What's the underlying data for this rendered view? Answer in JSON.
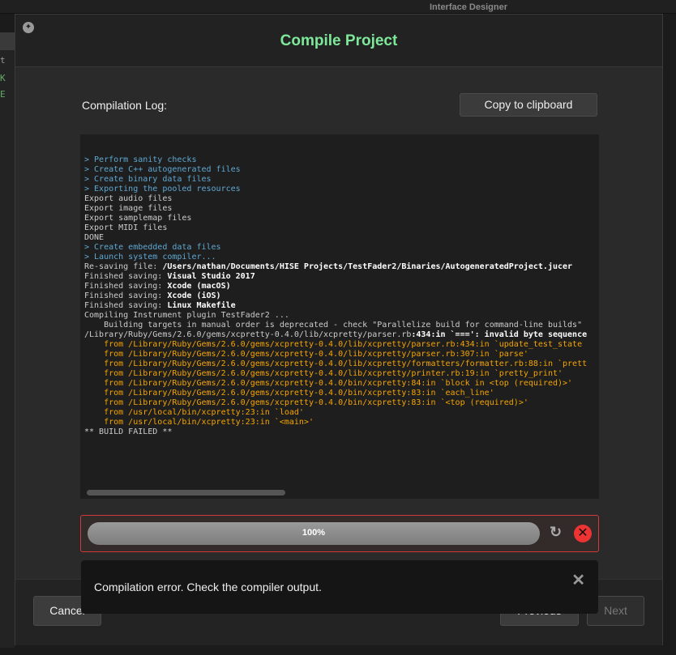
{
  "background": {
    "window_title": "Interface Designer",
    "left_items": [
      "t",
      "K",
      "E"
    ]
  },
  "dialog": {
    "title": "Compile Project",
    "log_label": "Compilation Log:",
    "copy_button": "Copy to clipboard",
    "log": [
      {
        "t": "> Perform sanity checks",
        "c": "blue"
      },
      {
        "t": "> Create C++ autogenerated files",
        "c": "blue"
      },
      {
        "t": "> Create binary data files",
        "c": "blue"
      },
      {
        "t": "> Exporting the pooled resources",
        "c": "blue"
      },
      {
        "t": "Export audio files",
        "c": ""
      },
      {
        "t": "Export image files",
        "c": ""
      },
      {
        "t": "Export samplemap files",
        "c": ""
      },
      {
        "t": "Export MIDI files",
        "c": ""
      },
      {
        "t": "DONE",
        "c": ""
      },
      {
        "t": "> Create embedded data files",
        "c": "blue"
      },
      {
        "t": "> Launch system compiler...",
        "c": "blue"
      },
      {
        "t": "Re-saving file:",
        "b": " /Users/nathan/Documents/HISE Projects/TestFader2/Binaries/AutogeneratedProject.jucer",
        "c": ""
      },
      {
        "t": "Finished saving:",
        "b": " Visual Studio 2017",
        "c": ""
      },
      {
        "t": "Finished saving:",
        "b": " Xcode (macOS)",
        "c": ""
      },
      {
        "t": "Finished saving:",
        "b": " Xcode (iOS)",
        "c": ""
      },
      {
        "t": "Finished saving:",
        "b": " Linux Makefile",
        "c": ""
      },
      {
        "t": "Compiling Instrument plugin TestFader2 ...",
        "c": ""
      },
      {
        "t": "    Building targets in manual order is deprecated - check \"Parallelize build for command-line builds\"",
        "c": ""
      },
      {
        "t": "/Library/Ruby/Gems/2.6.0/gems/xcpretty-0.4.0/lib/xcpretty/parser.rb",
        "b": ":434:in `===': invalid byte sequence",
        "c": ""
      },
      {
        "t": "    from /Library/Ruby/Gems/2.6.0/gems/xcpretty-0.4.0/lib/xcpretty/parser.rb:434:in `update_test_state",
        "c": "orange"
      },
      {
        "t": "    from /Library/Ruby/Gems/2.6.0/gems/xcpretty-0.4.0/lib/xcpretty/parser.rb:307:in `parse'",
        "c": "orange"
      },
      {
        "t": "    from /Library/Ruby/Gems/2.6.0/gems/xcpretty-0.4.0/lib/xcpretty/formatters/formatter.rb:88:in `prett",
        "c": "orange"
      },
      {
        "t": "    from /Library/Ruby/Gems/2.6.0/gems/xcpretty-0.4.0/lib/xcpretty/printer.rb:19:in `pretty_print'",
        "c": "orange"
      },
      {
        "t": "    from /Library/Ruby/Gems/2.6.0/gems/xcpretty-0.4.0/bin/xcpretty:84:in `block in <top (required)>'",
        "c": "orange"
      },
      {
        "t": "    from /Library/Ruby/Gems/2.6.0/gems/xcpretty-0.4.0/bin/xcpretty:83:in `each_line'",
        "c": "orange"
      },
      {
        "t": "    from /Library/Ruby/Gems/2.6.0/gems/xcpretty-0.4.0/bin/xcpretty:83:in `<top (required)>'",
        "c": "orange"
      },
      {
        "t": "    from /usr/local/bin/xcpretty:23:in `load'",
        "c": "orange"
      },
      {
        "t": "    from /usr/local/bin/xcpretty:23:in `<main>'",
        "c": "orange"
      },
      {
        "t": "** BUILD FAILED **",
        "c": ""
      }
    ],
    "progress": {
      "value": 100,
      "label": "100%",
      "status": "error"
    },
    "toast": "Compilation error. Check the compiler output.",
    "buttons": {
      "cancel": "Cancel",
      "previous": "Previous",
      "next": "Next"
    },
    "colors": {
      "title": "#7ee89a",
      "error": "#d23a3a",
      "log_info": "#5fa8d3",
      "log_warning": "#f5a500"
    }
  }
}
